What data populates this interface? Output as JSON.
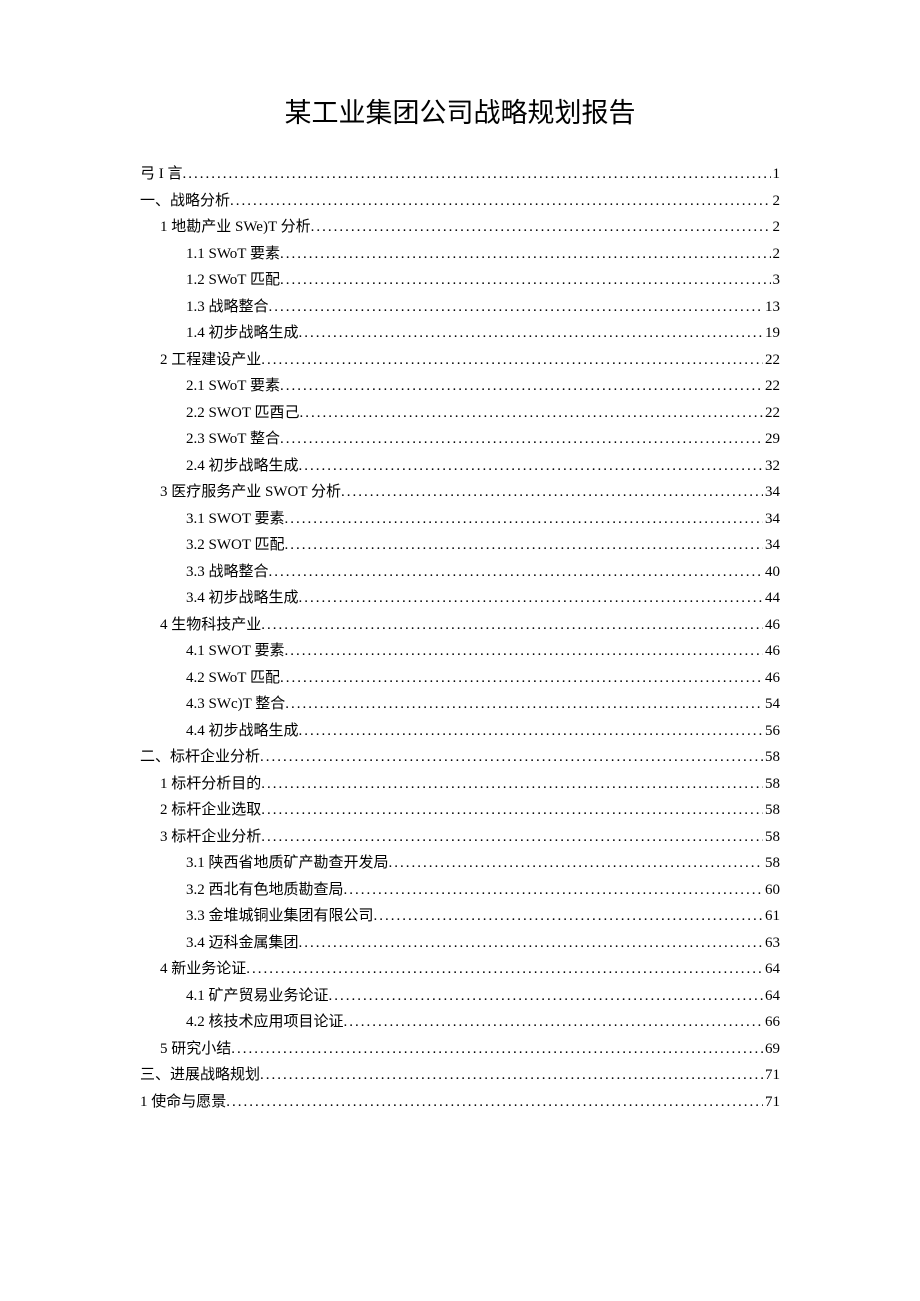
{
  "title": "某工业集团公司战略规划报告",
  "toc": [
    {
      "indent": 0,
      "label": "弓 I 言",
      "page": "1"
    },
    {
      "indent": 0,
      "label": "一、战略分析 ",
      "page": "2"
    },
    {
      "indent": 1,
      "label": "1 地勘产业 SWe)T 分析",
      "page": "2"
    },
    {
      "indent": 2,
      "label": "1.1   SWoT 要素 ",
      "page": "2"
    },
    {
      "indent": 2,
      "label": "1.2   SWoT 匹配 ",
      "page": "3"
    },
    {
      "indent": 2,
      "label": "1.3   战略整合 ",
      "page": "13"
    },
    {
      "indent": 2,
      "label": "1.4   初步战略生成 ",
      "page": "19"
    },
    {
      "indent": 1,
      "label": "2 工程建设产业",
      "page": "22"
    },
    {
      "indent": 2,
      "label": "2.1   SWoT 要素 ",
      "page": "22"
    },
    {
      "indent": 2,
      "label": "2.2   SWOT 匹酉己 ",
      "page": "22"
    },
    {
      "indent": 2,
      "label": "2.3   SWoT 整合",
      "page": "29"
    },
    {
      "indent": 2,
      "label": "2.4   初步战略生成 ",
      "page": "32"
    },
    {
      "indent": 1,
      "label": "3 医疗服务产业 SWOT 分析",
      "page": "34"
    },
    {
      "indent": 2,
      "label": "3.1   SWOT 要素 ",
      "page": "34"
    },
    {
      "indent": 2,
      "label": "3.2   SWOT 匹配 ",
      "page": "34"
    },
    {
      "indent": 2,
      "label": "3.3   战略整合 ",
      "page": "40"
    },
    {
      "indent": 2,
      "label": "3.4   初步战略生成 ",
      "page": "44"
    },
    {
      "indent": 1,
      "label": "4 生物科技产业",
      "page": "46"
    },
    {
      "indent": 2,
      "label": "4.1   SWOT 要素 ",
      "page": "46"
    },
    {
      "indent": 2,
      "label": "4.2   SWoT 匹配",
      "page": "46"
    },
    {
      "indent": 2,
      "label": "4.3   SWc)T 整合 ",
      "page": "54"
    },
    {
      "indent": 2,
      "label": "4.4   初步战略生成 ",
      "page": "56"
    },
    {
      "indent": 0,
      "label": "二、标杆企业分析 ",
      "page": "58"
    },
    {
      "indent": 1,
      "label": "1 标杆分析目的",
      "page": "58"
    },
    {
      "indent": 1,
      "label": "2 标杆企业选取",
      "page": "58"
    },
    {
      "indent": 1,
      "label": "3 标杆企业分析",
      "page": "58"
    },
    {
      "indent": 2,
      "label": "3.1   陕西省地质矿产勘查开发局 ",
      "page": "58"
    },
    {
      "indent": 2,
      "label": "3.2   西北有色地质勘查局",
      "page": "60"
    },
    {
      "indent": 2,
      "label": "3.3   金堆城铜业集团有限公司",
      "page": "61"
    },
    {
      "indent": 2,
      "label": "3.4   迈科金属集团",
      "page": "63"
    },
    {
      "indent": 1,
      "label": "4 新业务论证",
      "page": "64"
    },
    {
      "indent": 2,
      "label": "4.1   矿产贸易业务论证 ",
      "page": "64"
    },
    {
      "indent": 2,
      "label": "4.2   核技术应用项目论证",
      "page": "66"
    },
    {
      "indent": 1,
      "label": "5 研究小结",
      "page": "69"
    },
    {
      "indent": 0,
      "label": "三、进展战略规划 ",
      "page": "71"
    },
    {
      "indent": 0,
      "label": "1 使命与愿景",
      "page": "71"
    }
  ]
}
